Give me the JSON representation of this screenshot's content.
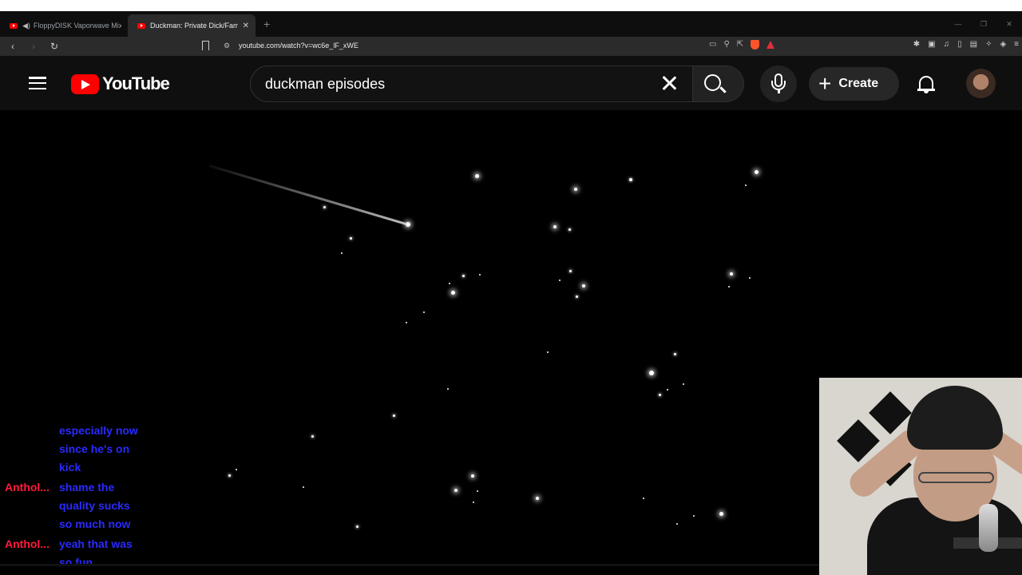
{
  "browser": {
    "tabs": [
      {
        "label": "FloppyDISK Vaporwave Mixx - Yo",
        "audio": true,
        "active": false
      },
      {
        "label": "Duckman: Private Dick/Family M",
        "audio": false,
        "active": true
      }
    ],
    "new_tab_label": "+",
    "url": "youtube.com/watch?v=wc6e_lF_xWE"
  },
  "youtube": {
    "logo_text": "YouTube",
    "search_query": "duckman episodes",
    "create_label": "Create"
  },
  "chat": {
    "messages": [
      {
        "user": "",
        "lines": [
          "especially now",
          "since he's on",
          "kick"
        ]
      },
      {
        "user": "Anthol...",
        "lines": [
          "shame the",
          "quality sucks",
          "so much now"
        ]
      },
      {
        "user": "Anthol...",
        "lines": [
          "yeah that was",
          "so fun"
        ]
      }
    ]
  },
  "colors": {
    "youtube_red": "#ff0000",
    "chat_user": "#ff1a3c",
    "chat_message": "#2a2aff",
    "header_bg": "#0f0f0f"
  },
  "icons": [
    "menu-icon",
    "youtube-logo",
    "clear-icon",
    "search-icon",
    "mic-icon",
    "plus-icon",
    "bell-icon",
    "avatar",
    "bookmark-icon",
    "back-icon",
    "forward-icon",
    "reload-icon"
  ]
}
